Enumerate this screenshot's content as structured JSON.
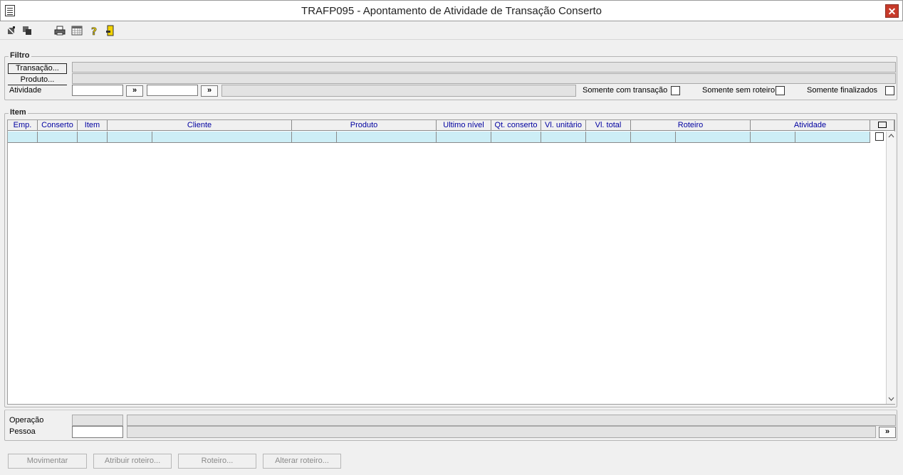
{
  "window": {
    "title": "TRAFP095 - Apontamento de Atividade de Transação Conserto",
    "close_symbol": "✕"
  },
  "toolbar": {
    "icons": [
      "first-record-icon",
      "copy-icon",
      "print-icon",
      "calendar-grid-icon",
      "help-icon",
      "exit-door-icon"
    ]
  },
  "filtro": {
    "group_label": "Filtro",
    "transacao_button": "Transação...",
    "produto_button": "Produto...",
    "atividade_label": "Atividade",
    "atividade_value_1": "",
    "atividade_value_2": "",
    "lookup_symbol": "»",
    "somente_com_transacao": "Somente com transação",
    "somente_sem_roteiro": "Somente sem roteiro",
    "somente_finalizados": "Somente finalizados"
  },
  "item": {
    "group_label": "Item",
    "columns": [
      "Emp.",
      "Conserto",
      "Item",
      "Cliente",
      "Produto",
      "Ultimo nível",
      "Qt. conserto",
      "Vl. unitário",
      "Vl. total",
      "Roteiro",
      "Atividade"
    ],
    "rows": []
  },
  "bottom": {
    "operacao_label": "Operação",
    "pessoa_label": "Pessoa",
    "lookup_symbol": "»"
  },
  "buttons": {
    "movimentar": "Movimentar",
    "atribuir_roteiro": "Atribuir roteiro...",
    "roteiro": "Roteiro...",
    "alterar_roteiro": "Alterar roteiro..."
  }
}
